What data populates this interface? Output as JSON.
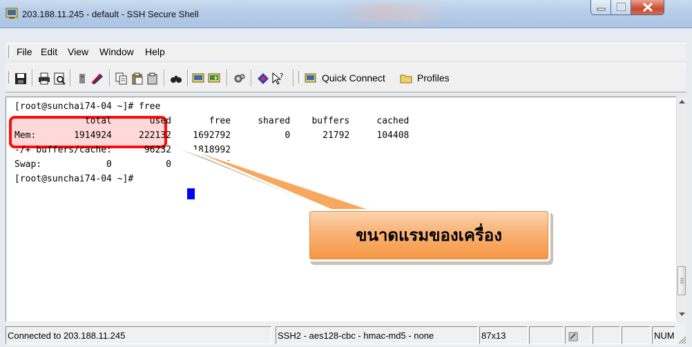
{
  "window": {
    "title": "203.188.11.245 - default - SSH Secure Shell"
  },
  "menu": {
    "items": [
      "File",
      "Edit",
      "View",
      "Window",
      "Help"
    ]
  },
  "toolbar": {
    "quick_connect_label": "Quick Connect",
    "profiles_label": "Profiles",
    "icons": [
      "save-icon",
      "print-icon",
      "print-preview-icon",
      "copy-icon",
      "paste-icon",
      "paste-alt-icon",
      "find-icon",
      "new-terminal-icon",
      "new-file-transfer-icon",
      "settings-icon",
      "help-icon",
      "context-help-icon"
    ]
  },
  "terminal": {
    "lines": [
      "[root@sunchai74-04 ~]# free",
      "             total       used       free     shared    buffers     cached",
      "Mem:       1914924     222132    1692792          0      21792     104408",
      "-/+ buffers/cache:      96232    1818992",
      "Swap:            0          0          0",
      "[root@sunchai74-04 ~]# "
    ],
    "cursor_color": "#0000ff"
  },
  "callout": {
    "text": "ขนาดแรมของเครื่อง",
    "fill_color": "#f59642",
    "highlight_color": "#ff0a0a"
  },
  "status": {
    "connection": "Connected to 203.188.11.245",
    "cipher": "SSH2 - aes128-cbc - hmac-md5 - none",
    "size": "87x13",
    "num": "NUM"
  }
}
